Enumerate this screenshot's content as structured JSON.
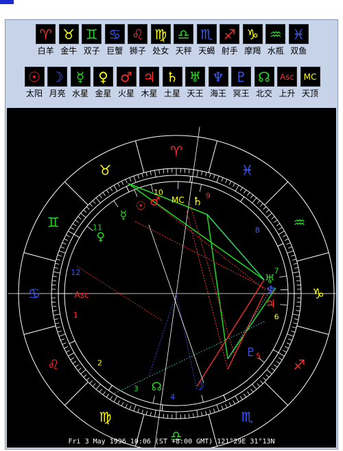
{
  "signs": [
    {
      "glyph": "♈",
      "label": "白羊",
      "color": "#ff2a2a"
    },
    {
      "glyph": "♉",
      "label": "金牛",
      "color": "#ffff00"
    },
    {
      "glyph": "♊",
      "label": "双子",
      "color": "#22dd22"
    },
    {
      "glyph": "♋",
      "label": "巨蟹",
      "color": "#3a5bff"
    },
    {
      "glyph": "♌",
      "label": "狮子",
      "color": "#ff2a2a"
    },
    {
      "glyph": "♍",
      "label": "处女",
      "color": "#ffff00"
    },
    {
      "glyph": "♎",
      "label": "天秤",
      "color": "#22dd22"
    },
    {
      "glyph": "♏",
      "label": "天蝎",
      "color": "#3a5bff"
    },
    {
      "glyph": "♐",
      "label": "射手",
      "color": "#ff2a2a"
    },
    {
      "glyph": "♑",
      "label": "摩羯",
      "color": "#ffff00"
    },
    {
      "glyph": "♒",
      "label": "水瓶",
      "color": "#22dd22"
    },
    {
      "glyph": "♓",
      "label": "双鱼",
      "color": "#3a5bff"
    }
  ],
  "planets": [
    {
      "glyph": "☉",
      "label": "太阳",
      "color": "#ff2a2a"
    },
    {
      "glyph": "☽",
      "label": "月亮",
      "color": "#3a5bff"
    },
    {
      "glyph": "☿",
      "label": "水星",
      "color": "#22dd22"
    },
    {
      "glyph": "♀",
      "label": "金星",
      "color": "#ffff00"
    },
    {
      "glyph": "♂",
      "label": "火星",
      "color": "#ff2a2a"
    },
    {
      "glyph": "♃",
      "label": "木星",
      "color": "#ff2a2a"
    },
    {
      "glyph": "♄",
      "label": "土星",
      "color": "#ffff00"
    },
    {
      "glyph": "♅",
      "label": "天王",
      "color": "#22dd22"
    },
    {
      "glyph": "♆",
      "label": "海王",
      "color": "#3a5bff"
    },
    {
      "glyph": "♇",
      "label": "冥王",
      "color": "#3a5bff"
    },
    {
      "glyph": "☊",
      "label": "北交",
      "color": "#22dd22"
    },
    {
      "glyph": "Asc",
      "label": "上升",
      "color": "#ff2a2a"
    },
    {
      "glyph": "MC",
      "label": "天顶",
      "color": "#ffff00"
    }
  ],
  "chart": {
    "footer": "Fri  3 May 1996 10:06 (ST +8:00 GMT) 121°29E 31°13N",
    "zodiac_marks": [
      {
        "glyph": "♈",
        "color": "#ff2a2a",
        "deg": 90
      },
      {
        "glyph": "♉",
        "color": "#ffff00",
        "deg": 120
      },
      {
        "glyph": "♊",
        "color": "#22dd22",
        "deg": 150
      },
      {
        "glyph": "♋",
        "color": "#3a5bff",
        "deg": 180
      },
      {
        "glyph": "♌",
        "color": "#ff2a2a",
        "deg": 210
      },
      {
        "glyph": "♍",
        "color": "#ffff00",
        "deg": 240
      },
      {
        "glyph": "♎",
        "color": "#22dd22",
        "deg": 270
      },
      {
        "glyph": "♏",
        "color": "#3a5bff",
        "deg": 300
      },
      {
        "glyph": "♐",
        "color": "#ff2a2a",
        "deg": 330
      },
      {
        "glyph": "♑",
        "color": "#ffff00",
        "deg": 0
      },
      {
        "glyph": "♒",
        "color": "#22dd22",
        "deg": 30
      },
      {
        "glyph": "♓",
        "color": "#3a5bff",
        "deg": 60
      }
    ],
    "house_numbers": [
      {
        "n": "1",
        "color": "#ff2a2a",
        "deg": 192
      },
      {
        "n": "2",
        "color": "#ffff00",
        "deg": 222
      },
      {
        "n": "3",
        "color": "#22dd22",
        "deg": 247
      },
      {
        "n": "4",
        "color": "#3a5bff",
        "deg": 268
      },
      {
        "n": "5",
        "color": "#ff2a2a",
        "deg": 323
      },
      {
        "n": "6",
        "color": "#ffff00",
        "deg": 347
      },
      {
        "n": "7",
        "color": "#22dd22",
        "deg": 13
      },
      {
        "n": "8",
        "color": "#3a5bff",
        "deg": 38
      },
      {
        "n": "9",
        "color": "#ff2a2a",
        "deg": 72
      },
      {
        "n": "10",
        "color": "#ffff00",
        "deg": 100
      },
      {
        "n": "11",
        "color": "#22dd22",
        "deg": 140
      },
      {
        "n": "12",
        "color": "#3a5bff",
        "deg": 168
      }
    ],
    "planet_marks": [
      {
        "glyph": "☉",
        "color": "#ff2a2a",
        "deg": 112
      },
      {
        "glyph": "♂",
        "color": "#ff2a2a",
        "deg": 103
      },
      {
        "glyph": "MC",
        "color": "#ffff00",
        "deg": 89
      },
      {
        "glyph": "♄",
        "color": "#ffff00",
        "deg": 77
      },
      {
        "glyph": "☿",
        "color": "#22dd22",
        "deg": 124
      },
      {
        "glyph": "♀",
        "color": "#22dd22",
        "deg": 143
      },
      {
        "glyph": "♅",
        "color": "#22dd22",
        "deg": 9
      },
      {
        "glyph": "♆",
        "color": "#3a5bff",
        "deg": 2
      },
      {
        "glyph": "♃",
        "color": "#ff2a2a",
        "deg": -6
      },
      {
        "glyph": "♇",
        "color": "#3a5bff",
        "deg": -38
      },
      {
        "glyph": "☽",
        "color": "#3a5bff",
        "deg": -76
      },
      {
        "glyph": "☊",
        "color": "#22dd22",
        "deg": -102
      },
      {
        "glyph": "Asc",
        "color": "#ff2a2a",
        "deg": 180
      }
    ]
  }
}
